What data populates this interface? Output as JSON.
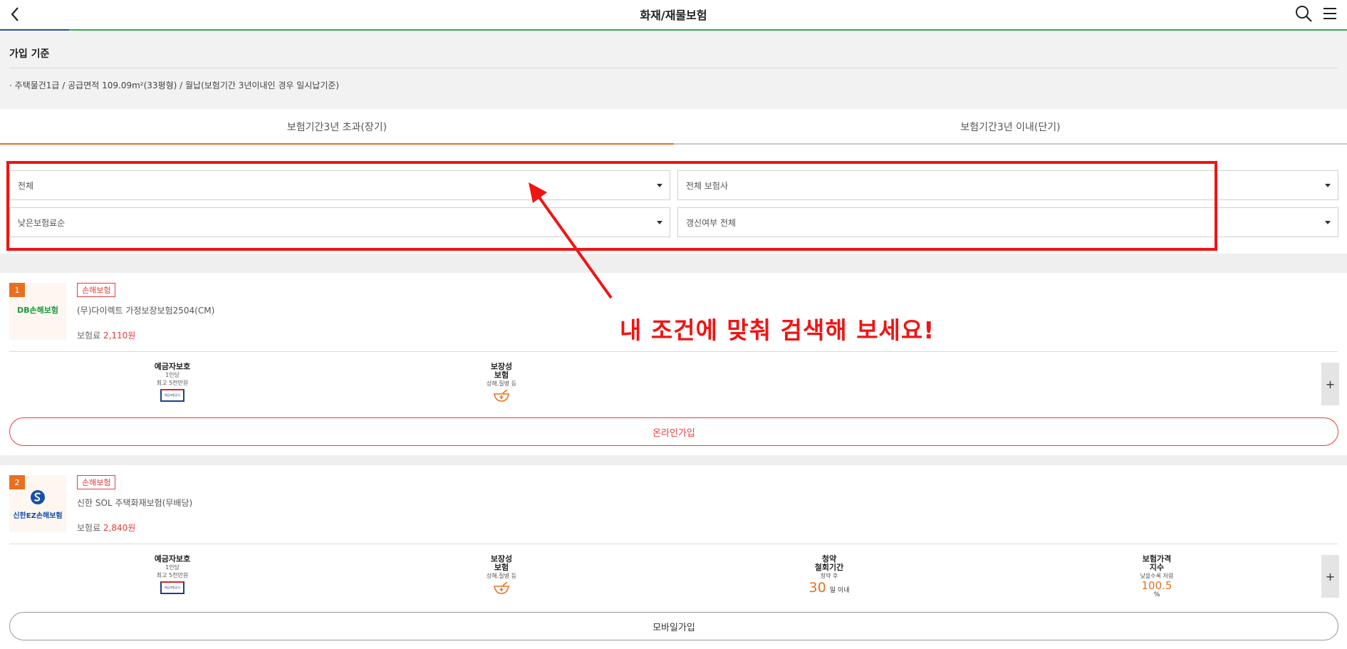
{
  "header": {
    "title": "화재/재물보험",
    "back_icon": "chevron-left-icon",
    "search_icon": "search-icon",
    "menu_icon": "hamburger-menu-icon"
  },
  "criteria": {
    "label": "가입 기준",
    "description": "· 주택물건1급 / 공급면적 109.09m²(33평형) / 월납(보험기간 3년이내인 경우 일시납기준)"
  },
  "tabs": [
    {
      "label": "보험기간3년 초과(장기)",
      "active": true
    },
    {
      "label": "보험기간3년 이내(단기)",
      "active": false
    }
  ],
  "filters": {
    "type": "전체",
    "insurer": "전체 보험사",
    "sort": "낮은보험료순",
    "renewal": "갱신여부 전체"
  },
  "callout": "내 조건에 맞춰 검색해 보세요!",
  "products": [
    {
      "rank": "1",
      "logo": "DB손해보험",
      "badge": "손해보험",
      "name": "(무)다이렉트 가정보장보험2504(CM)",
      "premium_label": "보험료 ",
      "premium_amount": "2,110원",
      "features": {
        "deposit_title": "예금자보호",
        "deposit_sub1": "1인당",
        "deposit_sub2": "최고 5천만원",
        "deposit_logo": "예금보험공사",
        "coverage_title1": "보장성",
        "coverage_title2": "보험",
        "coverage_sub": "상해,질병 등"
      },
      "join_label": "온라인가입"
    },
    {
      "rank": "2",
      "logo": "신한EZ손해보험",
      "badge": "손해보험",
      "name": "신한 SOL 주택화재보험(무배당)",
      "premium_label": "보험료 ",
      "premium_amount": "2,840원",
      "features": {
        "deposit_title": "예금자보호",
        "deposit_sub1": "1인당",
        "deposit_sub2": "최고 5천만원",
        "deposit_logo": "예금보험공사",
        "coverage_title1": "보장성",
        "coverage_title2": "보험",
        "coverage_sub": "상해,질병 등",
        "withdraw_title1": "청약",
        "withdraw_title2": "철회기간",
        "withdraw_sub": "청약 후",
        "withdraw_num": "30",
        "withdraw_unit": "일 이내",
        "price_title1": "보험가격",
        "price_title2": "지수",
        "price_sub": "낮을수록 저렴",
        "price_num": "100.5",
        "price_unit": "%"
      },
      "join_label": "모바일가입"
    }
  ],
  "colors": {
    "accent_orange": "#e8701f",
    "highlight_red": "#f01414",
    "header_green": "#2fa84f"
  }
}
